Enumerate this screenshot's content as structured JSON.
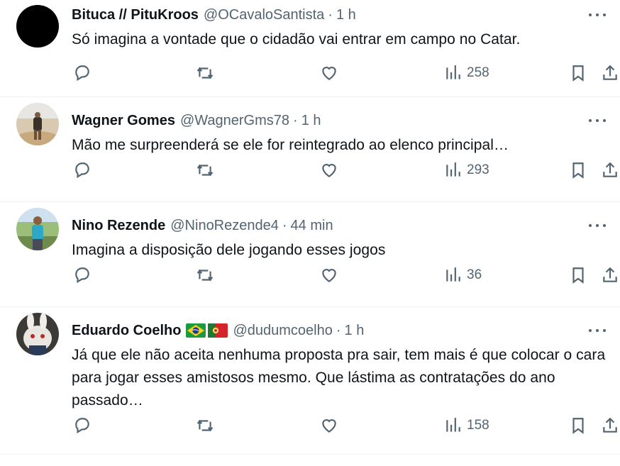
{
  "tweets": [
    {
      "name": "Bituca // PituKroos",
      "handle": "@OCavaloSantista",
      "time": "1 h",
      "text": "Só imagina a vontade que o cidadão vai entrar em campo no Catar.",
      "views": "258",
      "avatar_color": "#000000"
    },
    {
      "name": "Wagner Gomes",
      "handle": "@WagnerGms78",
      "time": "1 h",
      "text": "Mão me surpreenderá se ele for reintegrado ao elenco principal…",
      "views": "293"
    },
    {
      "name": "Nino Rezende",
      "handle": "@NinoRezende4",
      "time": "44 min",
      "text": "Imagina a disposição dele jogando esses jogos",
      "views": "36"
    },
    {
      "name": "Eduardo Coelho",
      "flags": [
        "brazil-flag",
        "portugal-flag"
      ],
      "handle": "@dudumcoelho",
      "time": "1 h",
      "text": "Já que ele não aceita nenhuma proposta pra sair, tem mais é que colocar o cara para jogar esses amistosos mesmo. Que lástima as contratações do ano passado…",
      "views": "158"
    }
  ],
  "separator": "·",
  "colors": {
    "text": "#0f1419",
    "secondary": "#536471",
    "divider": "#eff3f4"
  },
  "icons": [
    "reply-icon",
    "retweet-icon",
    "like-icon",
    "views-icon",
    "bookmark-icon",
    "share-icon",
    "more-icon"
  ]
}
